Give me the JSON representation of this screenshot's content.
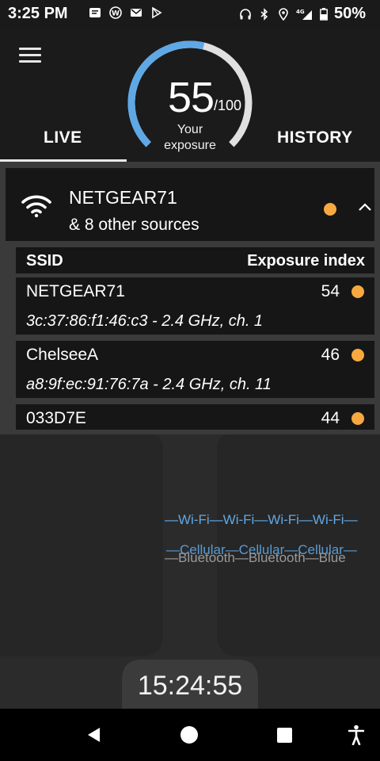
{
  "status_bar": {
    "time": "3:25 PM",
    "battery": "50%",
    "network_label": "4G",
    "left_icons": [
      "message-icon",
      "wordpress-icon",
      "gmail-icon",
      "play-store-icon"
    ],
    "right_icons": [
      "headphones-icon",
      "bluetooth-icon",
      "location-icon",
      "lte-signal-icon",
      "battery-icon"
    ]
  },
  "header": {
    "gauge": {
      "value": "55",
      "max": "/100",
      "label": "Your exposure",
      "fraction": 0.55
    },
    "tabs": {
      "live": "LIVE",
      "history": "HISTORY"
    },
    "active_tab": "LIVE"
  },
  "summary": {
    "title": "NETGEAR71",
    "subtitle": "& 8 other sources",
    "status_color": "#f7a940"
  },
  "table": {
    "col_ssid": "SSID",
    "col_index": "Exposure index",
    "rows": [
      {
        "ssid": "NETGEAR71",
        "value": "54",
        "detail": "3c:37:86:f1:46:c3 - 2.4 GHz, ch. 1"
      },
      {
        "ssid": "ChelseeA",
        "value": "46",
        "detail": "a8:9f:ec:91:76:7a - 2.4 GHz, ch. 11"
      },
      {
        "ssid": "033D7E",
        "value": "44"
      }
    ]
  },
  "viz": {
    "wifi_band": "—Wi-Fi—Wi-Fi—Wi-Fi—Wi-Fi—",
    "cellular_band": "—Cellular—Cellular—Cellular—",
    "bluetooth_band": "—Bluetooth—Bluetooth—Blue",
    "clock": "15:24:55"
  },
  "colors": {
    "accent_blue": "#5fa8e6",
    "dot_orange": "#f7a940",
    "gauge_track": "#e0e0e0"
  }
}
